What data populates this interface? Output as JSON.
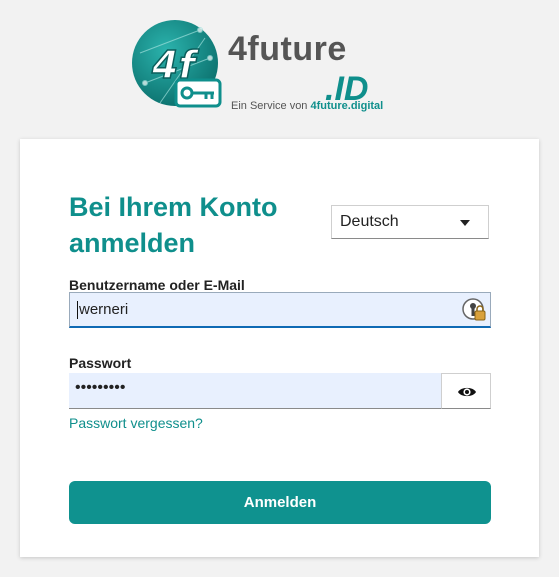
{
  "brand": {
    "name_main": "4future",
    "name_suffix": ".ID",
    "tagline_prefix": "Ein Service von",
    "tagline_brand": "4future.digital",
    "logo_mark_text": "4f",
    "accent_color": "#0f8f8c"
  },
  "login": {
    "title": "Bei Ihrem Konto anmelden",
    "language": {
      "selected": "Deutsch"
    },
    "username": {
      "label": "Benutzername oder E-Mail",
      "value": "werneri"
    },
    "password": {
      "label": "Passwort",
      "value": "•••••••••"
    },
    "forgot_password_link": "Passwort vergessen?",
    "submit_label": "Anmelden"
  },
  "icons": {
    "password_manager": "password-manager-icon",
    "show_password": "eye-icon",
    "language_dropdown": "caret-down-icon"
  }
}
